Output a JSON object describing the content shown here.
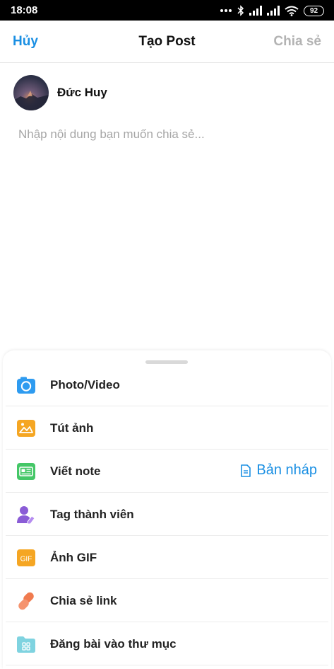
{
  "status_bar": {
    "time": "18:08",
    "battery": "92"
  },
  "header": {
    "cancel_label": "Hủy",
    "title": "Tạo Post",
    "share_label": "Chia sẻ"
  },
  "composer": {
    "user_name": "Đức Huy",
    "placeholder": "Nhập nội dung bạn muốn chia sẻ...",
    "value": ""
  },
  "menu": {
    "items": [
      {
        "label": "Photo/Video",
        "icon": "camera-icon",
        "color": "#2e9bf0"
      },
      {
        "label": "Tút ảnh",
        "icon": "image-edit-icon",
        "color": "#f5a623"
      },
      {
        "label": "Viết note",
        "icon": "note-icon",
        "color": "#44c767"
      },
      {
        "label": "Tag thành viên",
        "icon": "tag-user-icon",
        "color": "#8a5cd6"
      },
      {
        "label": "Ảnh GIF",
        "icon": "gif-icon",
        "color": "#f5a623"
      },
      {
        "label": "Chia sẻ link",
        "icon": "link-icon",
        "color": "#f07b4f"
      },
      {
        "label": "Đăng bài vào thư mục",
        "icon": "folder-icon",
        "color": "#7fd3e0"
      }
    ],
    "draft_label": "Bản nháp"
  },
  "colors": {
    "accent": "#1a8fe3",
    "disabled": "#b3b3b3"
  }
}
